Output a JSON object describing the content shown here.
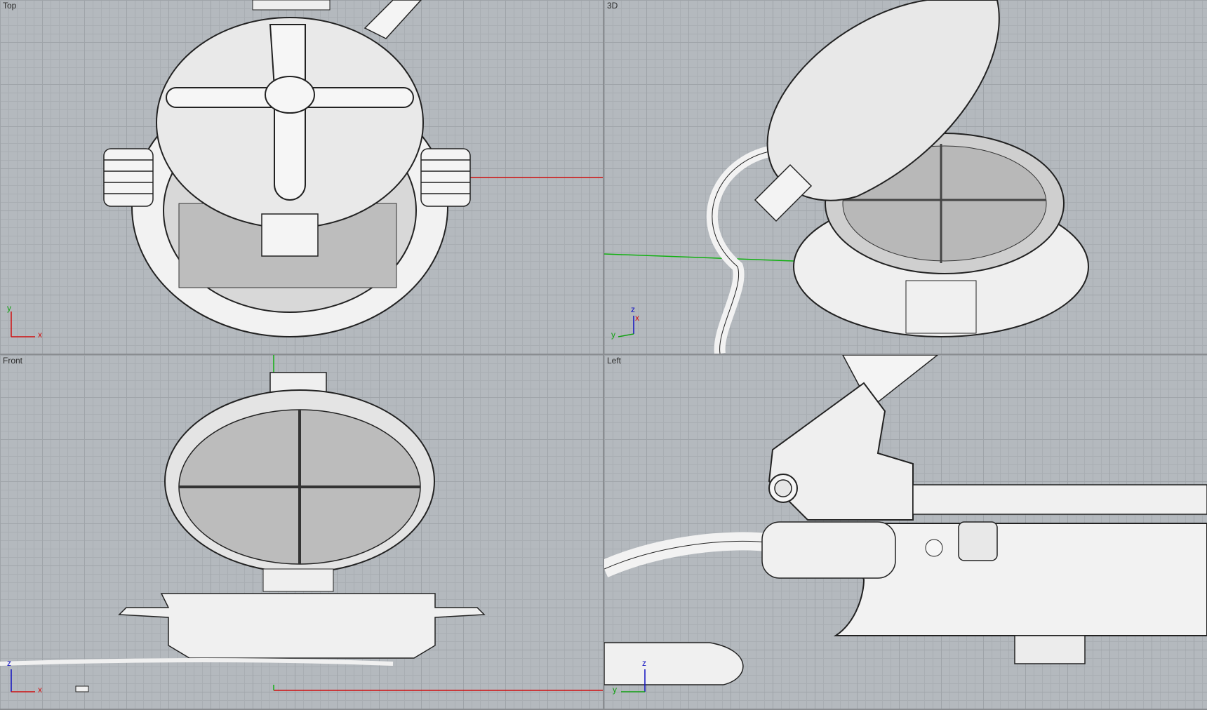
{
  "viewports": [
    {
      "title": "Top",
      "axes": {
        "v": "y",
        "h": "x"
      }
    },
    {
      "title": "3D",
      "axes": {
        "v": "z",
        "h": "y",
        "third": "x"
      }
    },
    {
      "title": "Front",
      "axes": {
        "v": "z",
        "h": "x"
      }
    },
    {
      "title": "Left",
      "axes": {
        "v": "z",
        "h": "y"
      }
    }
  ],
  "colors": {
    "viewport_bg": "#b4b9be",
    "grid_major": "#9fa4a9",
    "x_axis": "#d01010",
    "y_axis": "#10b010",
    "z_axis": "#1010c0"
  }
}
